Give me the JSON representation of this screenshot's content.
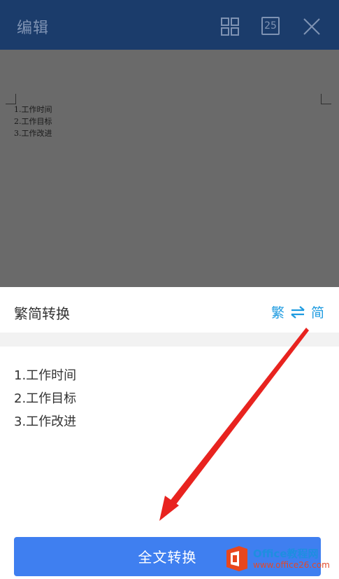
{
  "topbar": {
    "title": "编辑",
    "calendar_number": "25"
  },
  "preview": {
    "lines": [
      "1.工作时间",
      "2.工作目标",
      "3.工作改进"
    ]
  },
  "sheet": {
    "title": "繁简转换",
    "toggle_from": "繁",
    "toggle_to": "简",
    "result_lines": [
      "1.工作时间",
      "2.工作目标",
      "3.工作改进"
    ],
    "convert_label": "全文转换"
  },
  "watermark": {
    "line1": "Office教程网",
    "line2": "www.office26.com"
  },
  "colors": {
    "topbar_bg": "#1b3c6b",
    "accent_blue": "#1e9be0",
    "button_bg": "#3f7ff0",
    "arrow_red": "#e8231f",
    "preview_dim": "#6a6a6a"
  }
}
